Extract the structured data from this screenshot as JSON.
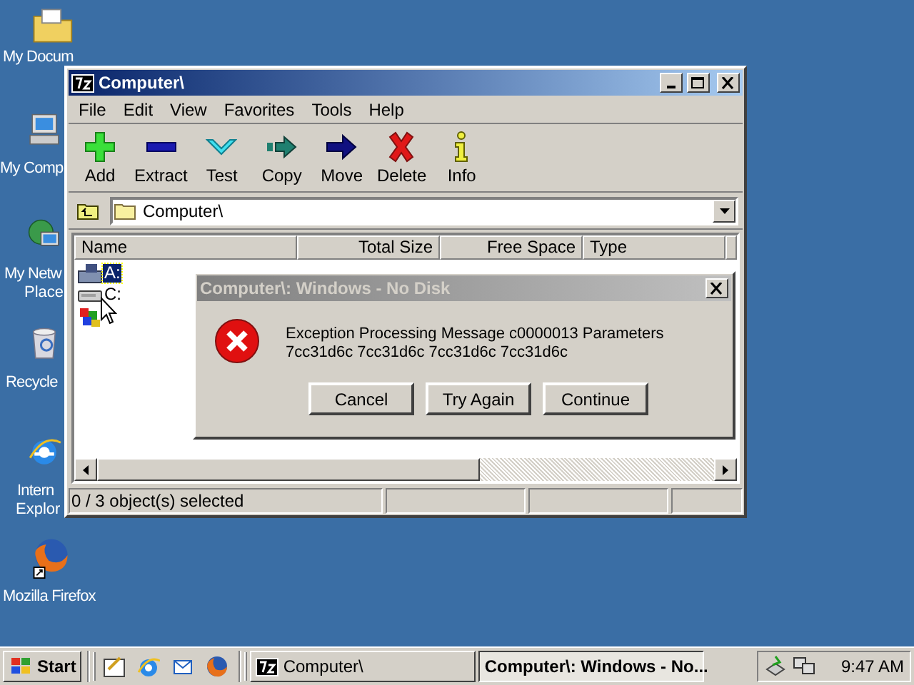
{
  "desktop_icons": [
    {
      "label": "My Docum",
      "kind": "documents"
    },
    {
      "label": "My Comp",
      "kind": "computer"
    },
    {
      "label": "My Netw",
      "label2": "Place",
      "kind": "network"
    },
    {
      "label": "Recycle",
      "kind": "recycle"
    },
    {
      "label": "Intern",
      "label2": "Explor",
      "kind": "ie"
    },
    {
      "label": "Mozilla Firefox",
      "kind": "firefox"
    }
  ],
  "window": {
    "title": "Computer\\",
    "menu": [
      "File",
      "Edit",
      "View",
      "Favorites",
      "Tools",
      "Help"
    ],
    "toolbar": [
      {
        "label": "Add",
        "kind": "add"
      },
      {
        "label": "Extract",
        "kind": "extract"
      },
      {
        "label": "Test",
        "kind": "test"
      },
      {
        "label": "Copy",
        "kind": "copy"
      },
      {
        "label": "Move",
        "kind": "move"
      },
      {
        "label": "Delete",
        "kind": "delete"
      },
      {
        "label": "Info",
        "kind": "info"
      }
    ],
    "address": "Computer\\",
    "columns": [
      "Name",
      "Total Size",
      "Free Space",
      "Type"
    ],
    "items": [
      {
        "name": "A:",
        "selected": true,
        "kind": "floppy"
      },
      {
        "name": "C:",
        "selected": false,
        "kind": "drive"
      },
      {
        "selected": false,
        "kind": "panel"
      }
    ],
    "status": "0 / 3 object(s) selected"
  },
  "dialog": {
    "title": "Computer\\: Windows - No Disk",
    "message": "Exception Processing Message c0000013 Parameters 7cc31d6c 7cc31d6c 7cc31d6c 7cc31d6c",
    "buttons": [
      "Cancel",
      "Try Again",
      "Continue"
    ]
  },
  "taskbar": {
    "start": "Start",
    "quick_launch": [
      {
        "kind": "desktop"
      },
      {
        "kind": "ie"
      },
      {
        "kind": "outlook"
      },
      {
        "kind": "firefox"
      }
    ],
    "tasks": [
      {
        "label": "Computer\\",
        "selected": false
      },
      {
        "label": "Computer\\: Windows - No...",
        "selected": true
      }
    ],
    "clock": "9:47 AM"
  }
}
